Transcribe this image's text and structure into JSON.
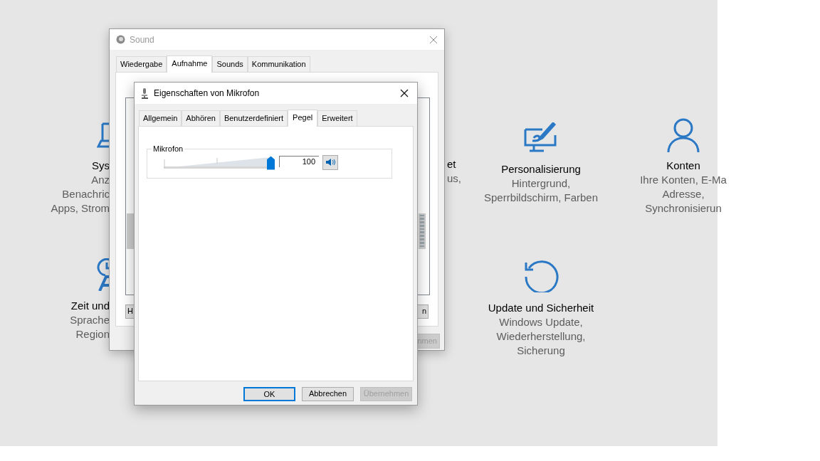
{
  "settings": {
    "left_items": [
      {
        "kind": "laptop",
        "title": "Sys",
        "lines": [
          "Anz",
          "Benachric",
          "Apps, Strom"
        ]
      },
      {
        "kind": "clock",
        "title": "Zeit und",
        "lines": [
          "Sprache",
          "Region"
        ]
      }
    ],
    "covered_fragments": [
      "et",
      "us,"
    ],
    "items": [
      {
        "kind": "paint",
        "title": "Personalisierung",
        "lines": [
          "Hintergrund,",
          "Sperrbildschirm, Farben"
        ]
      },
      {
        "kind": "person",
        "title": "Konten",
        "lines": [
          "Ihre Konten, E-Ma",
          "Adresse,",
          "Synchronisierun"
        ]
      },
      {
        "kind": "update",
        "title": "Update und Sicherheit",
        "lines": [
          "Windows Update,",
          "Wiederherstellung,",
          "Sicherung"
        ]
      }
    ]
  },
  "sound_window": {
    "title": "Sound",
    "tabs": [
      {
        "label": "Wiedergabe",
        "selected": false
      },
      {
        "label": "Aufnahme",
        "selected": true
      },
      {
        "label": "Sounds",
        "selected": false
      },
      {
        "label": "Kommunikation",
        "selected": false
      }
    ],
    "button_fragments": [
      {
        "label": "H",
        "disabled": false
      },
      {
        "label": "n",
        "disabled": false
      },
      {
        "label": "nmen",
        "disabled": true
      }
    ]
  },
  "dialog": {
    "title": "Eigenschaften von Mikrofon",
    "tabs": [
      {
        "label": "Allgemein",
        "selected": false
      },
      {
        "label": "Abhören",
        "selected": false
      },
      {
        "label": "Benutzerdefiniert",
        "selected": false
      },
      {
        "label": "Pegel",
        "selected": true
      },
      {
        "label": "Erweitert",
        "selected": false
      }
    ],
    "group": {
      "label": "Mikrofon",
      "level": 1,
      "value": "100",
      "muted": false
    },
    "buttons": [
      {
        "label": "OK",
        "default": true,
        "disabled": false
      },
      {
        "label": "Abbrechen",
        "default": false,
        "disabled": false
      },
      {
        "label": "Übernehmen",
        "default": false,
        "disabled": true
      }
    ]
  }
}
